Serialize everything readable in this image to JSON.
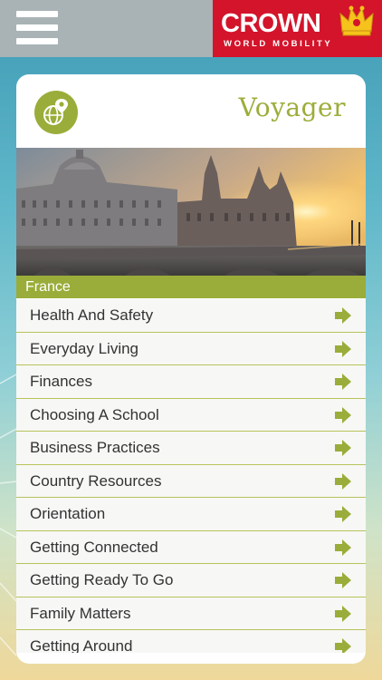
{
  "header": {
    "menu_icon": "hamburger-menu-icon",
    "brand_name": "CROWN",
    "brand_sub": "WORLD MOBILITY",
    "brand_icon": "crown-icon",
    "brand_color": "#d3142b"
  },
  "app": {
    "title": "Voyager",
    "badge_icon": "globe-pin-icon",
    "accent_color": "#9aad3a"
  },
  "hero_image": {
    "description_icon": "paris-conciergerie-photo"
  },
  "country": {
    "name": "France"
  },
  "menu": {
    "arrow_icon": "right-arrow-icon",
    "items": [
      {
        "label": "Health And Safety"
      },
      {
        "label": "Everyday Living"
      },
      {
        "label": "Finances"
      },
      {
        "label": "Choosing A School"
      },
      {
        "label": "Business Practices"
      },
      {
        "label": "Country Resources"
      },
      {
        "label": "Orientation"
      },
      {
        "label": "Getting Connected"
      },
      {
        "label": "Getting Ready To Go"
      },
      {
        "label": "Family Matters"
      },
      {
        "label": "Getting Around"
      }
    ]
  }
}
